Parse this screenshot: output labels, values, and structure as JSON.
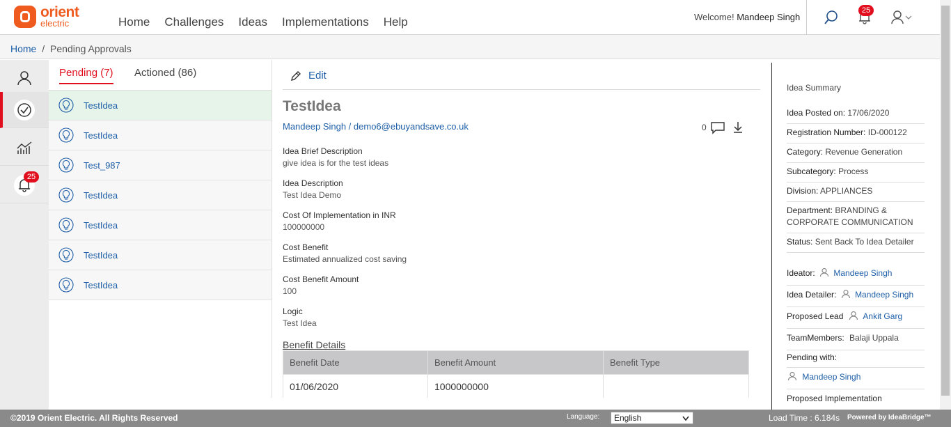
{
  "brand": {
    "line1": "orient",
    "line2": "electric"
  },
  "nav": [
    "Home",
    "Challenges",
    "Ideas",
    "Implementations",
    "Help"
  ],
  "header": {
    "welcome_prefix": "Welcome!",
    "user_name": "Mandeep Singh",
    "notification_count": "25"
  },
  "breadcrumb": {
    "home": "Home",
    "separator": "/",
    "current": "Pending Approvals"
  },
  "rail": {
    "notification_count": "25"
  },
  "tabs": {
    "pending": "Pending (7)",
    "actioned": "Actioned (86)"
  },
  "ideas": [
    {
      "name": "TestIdea"
    },
    {
      "name": "TestIdea"
    },
    {
      "name": "Test_987"
    },
    {
      "name": "TestIdea"
    },
    {
      "name": "TestIdea"
    },
    {
      "name": "TestIdea"
    },
    {
      "name": "TestIdea"
    }
  ],
  "detail": {
    "edit_label": "Edit",
    "title": "TestIdea",
    "author": "Mandeep Singh / demo6@ebuyandsave.co.uk",
    "comment_count": "0",
    "fields": [
      {
        "label": "Idea Brief Description",
        "value": "give idea is for the test ideas"
      },
      {
        "label": "Idea Description",
        "value": "Test Idea Demo"
      },
      {
        "label": "Cost Of Implementation in INR",
        "value": "100000000"
      },
      {
        "label": "Cost Benefit",
        "value": "Estimated annualized cost saving"
      },
      {
        "label": "Cost Benefit Amount",
        "value": "100"
      },
      {
        "label": "Logic",
        "value": "Test Idea"
      }
    ],
    "benefit_title": "Benefit Details",
    "benefit_headers": [
      "Benefit Date",
      "Benefit Amount",
      "Benefit Type"
    ],
    "benefit_rows": [
      [
        "01/06/2020",
        "1000000000",
        ""
      ]
    ]
  },
  "summary": {
    "heading": "Idea Summary",
    "posted_label": "Idea Posted on:",
    "posted": "17/06/2020",
    "reg_label": "Registration Number:",
    "reg": "ID-000122",
    "category_label": "Category:",
    "category": "Revenue Generation",
    "subcategory_label": "Subcategory:",
    "subcategory": "Process",
    "division_label": "Division:",
    "division": "APPLIANCES",
    "department_label": "Department:",
    "department": "BRANDING & CORPORATE COMMUNICATION",
    "status_label": "Status:",
    "status": "Sent Back To Idea Detailer",
    "ideator_label": "Ideator:",
    "ideator": "Mandeep Singh",
    "detailer_label": "Idea Detailer:",
    "detailer": "Mandeep Singh",
    "lead_label": "Proposed Lead",
    "lead": "Ankit Garg",
    "team_label": "TeamMembers:",
    "team": "Balaji Uppala",
    "pending_label": "Pending with:",
    "pending_with": "Mandeep Singh",
    "impl_label": "Proposed Implementation"
  },
  "footer": {
    "copyright": "©2019 Orient Electric. All Rights Reserved",
    "language_label": "Language:",
    "language": "English",
    "load_time": "Load Time : 6.184s",
    "powered": "Powered by IdeaBridge™"
  },
  "colors": {
    "brand": "#ef5b1f",
    "accent_red": "#e10e1e",
    "link": "#1f5fa8",
    "selected_row": "#e6f4ea"
  }
}
